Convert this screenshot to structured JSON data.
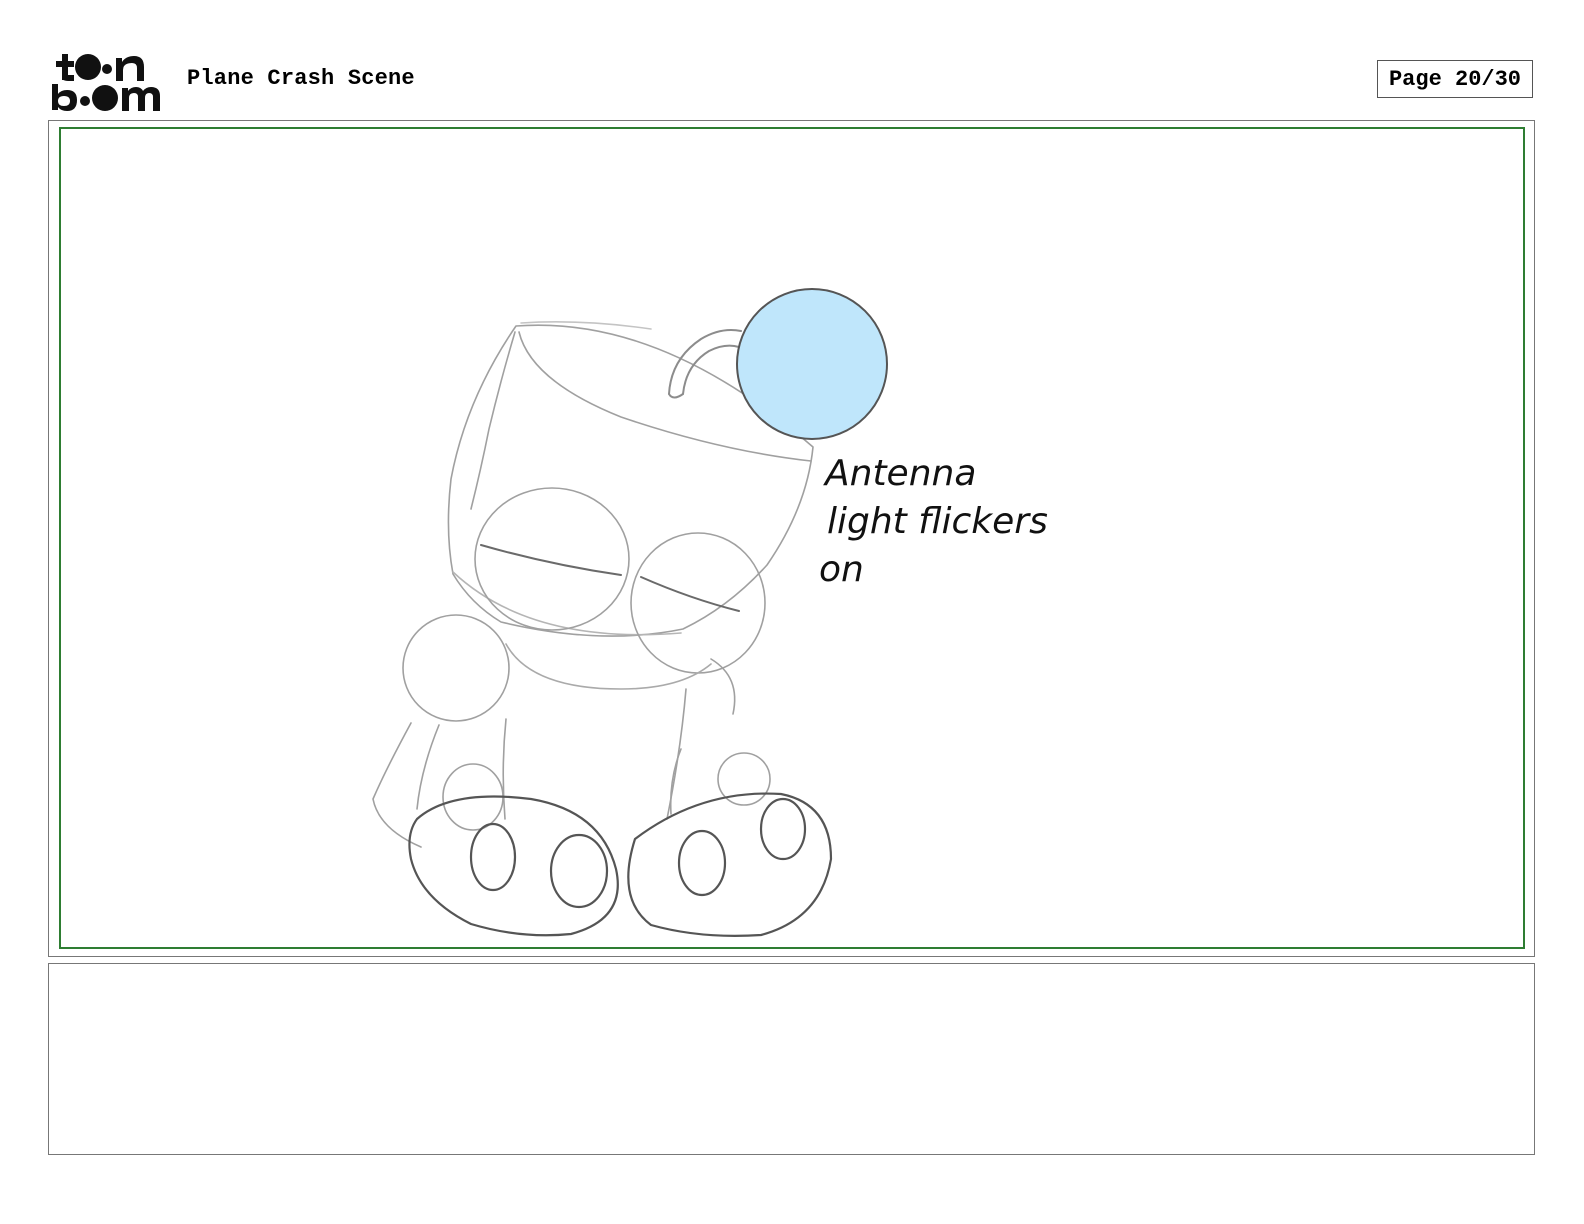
{
  "header": {
    "logo_text_top": "toon",
    "logo_text_bottom": "boom",
    "scene_title": "Plane Crash Scene",
    "page_label": "Page 20/30"
  },
  "panel": {
    "annotation_lines": [
      "Antenna",
      "light flickers",
      "on"
    ]
  },
  "notes": {
    "text": ""
  },
  "colors": {
    "frame_border": "#2e7d32",
    "antenna_light": "#bfe6fb",
    "sketch_line": "#9a9a9a"
  }
}
